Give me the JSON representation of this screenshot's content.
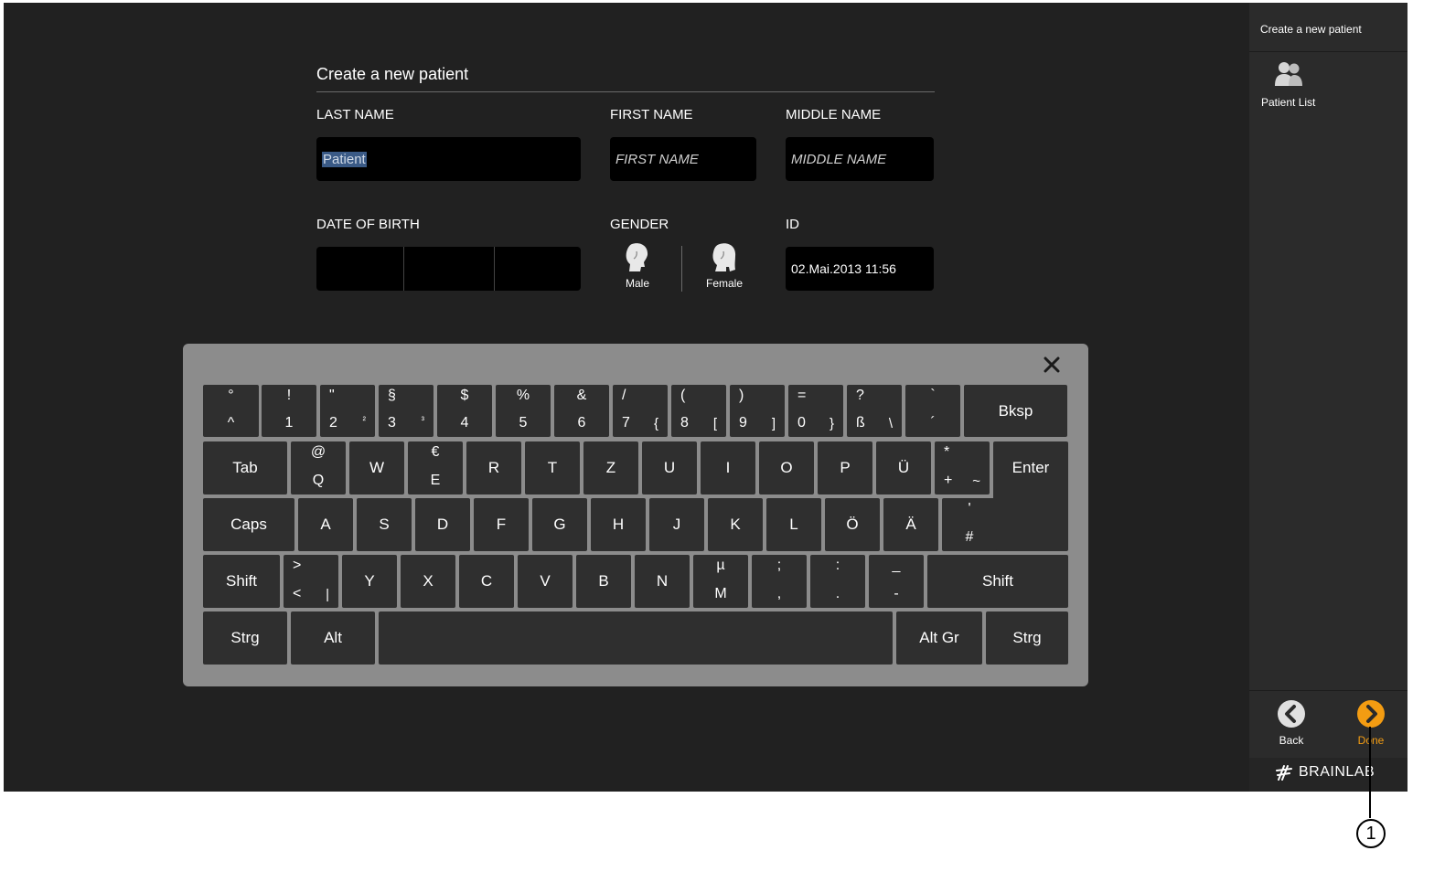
{
  "form": {
    "title": "Create a new patient",
    "last_name": {
      "label": "LAST NAME",
      "value": "Patient"
    },
    "first_name": {
      "label": "FIRST NAME",
      "placeholder": "FIRST NAME"
    },
    "middle_name": {
      "label": "MIDDLE NAME",
      "placeholder": "MIDDLE NAME"
    },
    "dob": {
      "label": "DATE OF BIRTH"
    },
    "gender": {
      "label": "GENDER",
      "male": "Male",
      "female": "Female"
    },
    "id": {
      "label": "ID",
      "value": "02.Mai.2013 11:56"
    }
  },
  "keyboard": {
    "rows": [
      [
        {
          "top": "°",
          "bottom": "^"
        },
        {
          "top": "!",
          "bottom": "1"
        },
        {
          "top": "\"",
          "bottom": "2",
          "sub": "²"
        },
        {
          "top": "§",
          "bottom": "3",
          "sub": "³"
        },
        {
          "top": "$",
          "bottom": "4"
        },
        {
          "top": "%",
          "bottom": "5"
        },
        {
          "top": "&",
          "bottom": "6"
        },
        {
          "top": "/",
          "bottom": "7",
          "sub": "{"
        },
        {
          "top": "(",
          "bottom": "8",
          "sub": "["
        },
        {
          "top": ")",
          "bottom": "9",
          "sub": "]"
        },
        {
          "top": "=",
          "bottom": "0",
          "sub": "}"
        },
        {
          "top": "?",
          "bottom": "ß",
          "sub": "\\"
        },
        {
          "top": "`",
          "bottom": "´"
        },
        {
          "label": "Bksp"
        }
      ],
      [
        {
          "label": "Tab"
        },
        {
          "top": "@",
          "bottom": "Q"
        },
        {
          "label": "W"
        },
        {
          "top": "€",
          "bottom": "E"
        },
        {
          "label": "R"
        },
        {
          "label": "T"
        },
        {
          "label": "Z"
        },
        {
          "label": "U"
        },
        {
          "label": "I"
        },
        {
          "label": "O"
        },
        {
          "label": "P"
        },
        {
          "label": "Ü"
        },
        {
          "top": "*",
          "bottom": "+",
          "sub": "~"
        },
        {
          "label": "Enter"
        }
      ],
      [
        {
          "label": "Caps"
        },
        {
          "label": "A"
        },
        {
          "label": "S"
        },
        {
          "label": "D"
        },
        {
          "label": "F"
        },
        {
          "label": "G"
        },
        {
          "label": "H"
        },
        {
          "label": "J"
        },
        {
          "label": "K"
        },
        {
          "label": "L"
        },
        {
          "label": "Ö"
        },
        {
          "label": "Ä"
        },
        {
          "top": "'",
          "bottom": "#"
        }
      ],
      [
        {
          "label": "Shift"
        },
        {
          "top": ">",
          "bottom": "<",
          "sub": "|"
        },
        {
          "label": "Y"
        },
        {
          "label": "X"
        },
        {
          "label": "C"
        },
        {
          "label": "V"
        },
        {
          "label": "B"
        },
        {
          "label": "N"
        },
        {
          "top": "µ",
          "bottom": "M"
        },
        {
          "top": ";",
          "bottom": ","
        },
        {
          "top": ":",
          "bottom": "."
        },
        {
          "top": "_",
          "bottom": "-"
        },
        {
          "label": "Shift"
        }
      ],
      [
        {
          "label": "Strg"
        },
        {
          "label": "Alt"
        },
        {
          "label": ""
        },
        {
          "label": "Alt Gr"
        },
        {
          "label": "Strg"
        }
      ]
    ]
  },
  "sidebar": {
    "title": "Create a new patient",
    "patient_list": "Patient List",
    "back": "Back",
    "done": "Done",
    "brand": "BRAINLAB"
  },
  "callout": "1",
  "colors": {
    "accent": "#f39c12",
    "background": "#212121",
    "sidebar": "#2b2b2b",
    "key": "#2f2f2f",
    "keyboard_frame": "#8c8c8c"
  }
}
